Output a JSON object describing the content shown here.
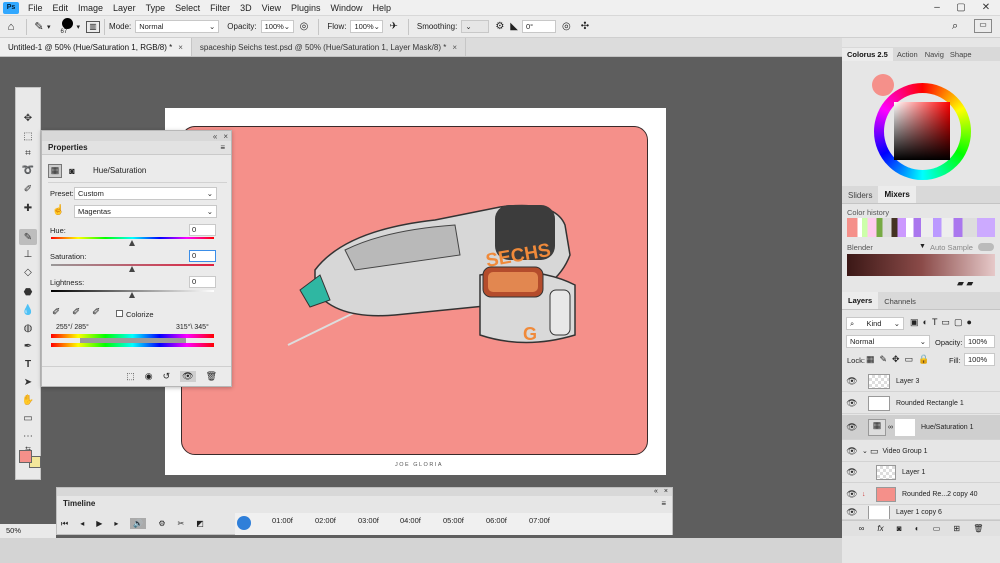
{
  "menu": [
    "File",
    "Edit",
    "Image",
    "Layer",
    "Type",
    "Select",
    "Filter",
    "3D",
    "View",
    "Plugins",
    "Window",
    "Help"
  ],
  "app_logo": "Ps",
  "options": {
    "brush_size": "67",
    "mode_label": "Mode:",
    "mode_value": "Normal",
    "opacity_label": "Opacity:",
    "opacity_value": "100%",
    "flow_label": "Flow:",
    "flow_value": "100%",
    "smoothing_label": "Smoothing:",
    "angle_value": "0°"
  },
  "tabs": [
    {
      "label": "Untitled-1 @ 50% (Hue/Saturation 1, RGB/8) *"
    },
    {
      "label": "spaceship Seichs test.psd @ 50% (Hue/Saturation 1, Layer Mask/8) *"
    }
  ],
  "document": {
    "ship_text": "SECHS",
    "ship_letter": "G",
    "watermark": "JOE GLORIA"
  },
  "properties": {
    "title": "Properties",
    "adjustment_name": "Hue/Saturation",
    "preset_label": "Preset:",
    "preset_value": "Custom",
    "channel_value": "Magentas",
    "hue_label": "Hue:",
    "hue_value": "0",
    "saturation_label": "Saturation:",
    "saturation_value": "0",
    "lightness_label": "Lightness:",
    "lightness_value": "0",
    "colorize_label": "Colorize",
    "range_left": "255°/ 285°",
    "range_right": "315°\\ 345°"
  },
  "right_panel": {
    "colour_tabs": [
      "Colorus 2.5",
      "Action",
      "Navig",
      "Shape"
    ],
    "sub_tabs": [
      "Sliders",
      "Mixers"
    ],
    "color_history_label": "Color history",
    "blender_label": "Blender",
    "auto_sample_label": "Auto Sample",
    "layer_tabs": [
      "Layers",
      "Channels"
    ],
    "kind_label": "Kind",
    "blend_mode": "Normal",
    "opacity_label": "Opacity:",
    "opacity_value": "100%",
    "lock_label": "Lock:",
    "fill_label": "Fill:",
    "fill_value": "100%",
    "layers": [
      {
        "name": "Layer 3"
      },
      {
        "name": "Rounded Rectangle 1"
      },
      {
        "name": "Hue/Saturation 1"
      },
      {
        "name": "Video Group 1"
      },
      {
        "name": "Layer 1"
      },
      {
        "name": "Rounded Re...2 copy 40"
      },
      {
        "name": "Layer 1 copy 6"
      }
    ]
  },
  "timeline": {
    "title": "Timeline",
    "ticks": [
      "01:00f",
      "02:00f",
      "03:00f",
      "04:00f",
      "05:00f",
      "06:00f",
      "07:00f"
    ]
  },
  "status": {
    "zoom": "50%"
  },
  "colors": {
    "pink": "#f5908a",
    "accent": "#31a8ff",
    "foreground": "#f5908a",
    "background": "#f3e79b"
  }
}
